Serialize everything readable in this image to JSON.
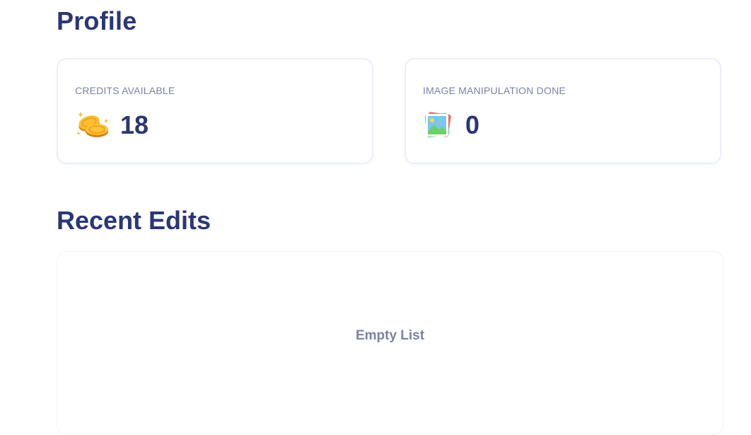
{
  "profile": {
    "title": "Profile"
  },
  "stats": [
    {
      "label": "CREDITS AVAILABLE",
      "value": "18",
      "icon": "coins-icon"
    },
    {
      "label": "IMAGE MANIPULATION DONE",
      "value": "0",
      "icon": "image-gallery-icon"
    }
  ],
  "recent_edits": {
    "title": "Recent Edits",
    "empty_text": "Empty List"
  },
  "colors": {
    "heading": "#2b3674",
    "muted": "#7b82a3",
    "card_border": "#eceefa"
  }
}
